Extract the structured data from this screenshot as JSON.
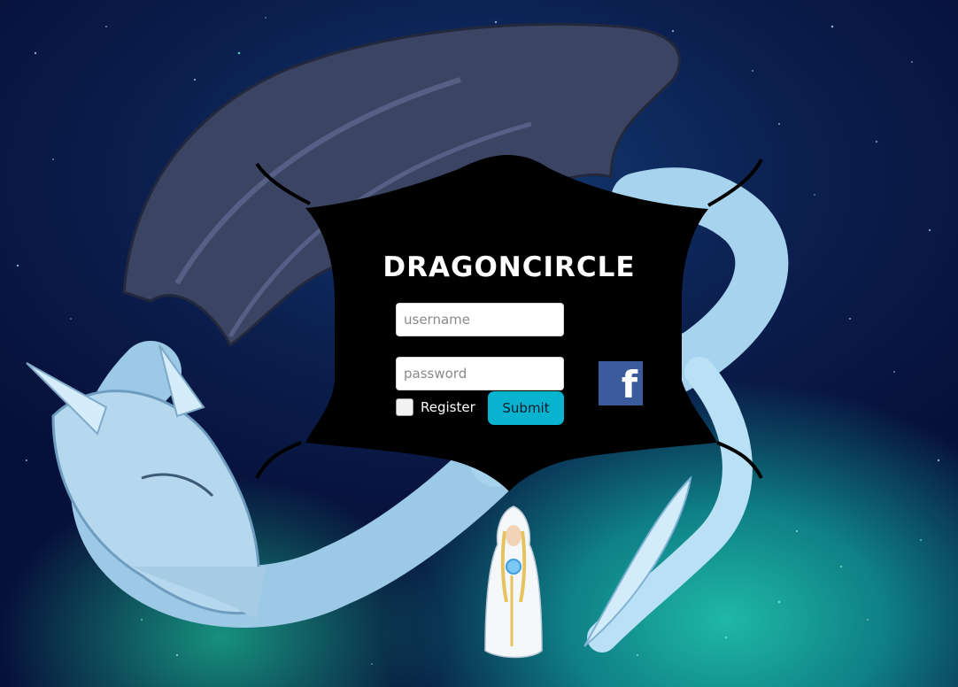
{
  "brand": {
    "logo_text": "DRAGONCIRCLE"
  },
  "login": {
    "username_placeholder": "username",
    "password_placeholder": "password",
    "register_label": "Register",
    "submit_label": "Submit"
  },
  "social": {
    "facebook_glyph": "f",
    "icon": "facebook-icon"
  },
  "colors": {
    "submit_bg": "#08b3cf",
    "facebook_bg": "#3b5b9c",
    "panel_bg": "#000000"
  }
}
